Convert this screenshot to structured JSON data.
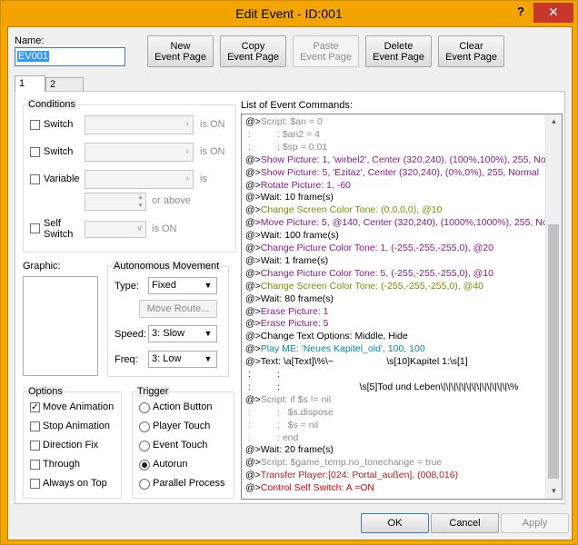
{
  "window": {
    "title": "Edit Event - ID:001",
    "help": "?",
    "close": "✕"
  },
  "name_label": "Name:",
  "name_value": "EV001",
  "top_buttons": [
    {
      "line1": "New",
      "line2": "Event Page"
    },
    {
      "line1": "Copy",
      "line2": "Event Page"
    },
    {
      "line1": "Paste",
      "line2": "Event Page"
    },
    {
      "line1": "Delete",
      "line2": "Event Page"
    },
    {
      "line1": "Clear",
      "line2": "Event Page"
    }
  ],
  "tabs": [
    "1",
    "2"
  ],
  "conditions": {
    "title": "Conditions",
    "switch1": "Switch",
    "switch2": "Switch",
    "variable": "Variable",
    "is_on1": "is ON",
    "is_on2": "is ON",
    "is": "is",
    "or_above": "or above",
    "self_switch_l1": "Self",
    "self_switch_l2": "Switch",
    "is_on3": "is ON"
  },
  "graphic_label": "Graphic:",
  "autonomous": {
    "title": "Autonomous Movement",
    "type_label": "Type:",
    "type_value": "Fixed",
    "move_route": "Move Route...",
    "speed_label": "Speed:",
    "speed_value": "3: Slow",
    "freq_label": "Freq:",
    "freq_value": "3: Low"
  },
  "options": {
    "title": "Options",
    "items": [
      {
        "label": "Move Animation",
        "checked": true
      },
      {
        "label": "Stop Animation",
        "checked": false
      },
      {
        "label": "Direction Fix",
        "checked": false
      },
      {
        "label": "Through",
        "checked": false
      },
      {
        "label": "Always on Top",
        "checked": false
      }
    ]
  },
  "trigger": {
    "title": "Trigger",
    "items": [
      {
        "label": "Action Button",
        "selected": false
      },
      {
        "label": "Player Touch",
        "selected": false
      },
      {
        "label": "Event Touch",
        "selected": false
      },
      {
        "label": "Autorun",
        "selected": true
      },
      {
        "label": "Parallel Process",
        "selected": false
      }
    ]
  },
  "list_label": "List of Event Commands:",
  "colors": {
    "script": "#8c8c8c",
    "picture": "#8b1a8b",
    "tone": "#7a8c00",
    "play": "#0088aa",
    "transfer": "#b22222",
    "switch": "#e00000",
    "default": "#000000"
  },
  "commands": [
    {
      "text": "@>Script: $an = 0",
      "c": "script"
    },
    {
      "text": " :          : $an2 = 4",
      "c": "script"
    },
    {
      "text": " :          : $sp = 0.01",
      "c": "script"
    },
    {
      "text": "@>Show Picture: 1, 'wirbel2', Center (320,240), (100%,100%), 255, Norm",
      "c": "picture"
    },
    {
      "text": "@>Show Picture: 5, 'Ezitaz', Center (320,240), (0%,0%), 255, Normal",
      "c": "picture"
    },
    {
      "text": "@>Rotate Picture: 1, -60",
      "c": "picture"
    },
    {
      "text": "@>Wait: 10 frame(s)",
      "c": "default"
    },
    {
      "text": "@>Change Screen Color Tone: (0,0,0,0), @10",
      "c": "tone"
    },
    {
      "text": "@>Move Picture: 5, @140, Center (320,240), (1000%,1000%), 255, Norm",
      "c": "picture"
    },
    {
      "text": "@>Wait: 100 frame(s)",
      "c": "default"
    },
    {
      "text": "@>Change Picture Color Tone: 1, (-255,-255,-255,0), @20",
      "c": "picture"
    },
    {
      "text": "@>Wait: 1 frame(s)",
      "c": "default"
    },
    {
      "text": "@>Change Picture Color Tone: 5, (-255,-255,-255,0), @10",
      "c": "picture"
    },
    {
      "text": "@>Change Screen Color Tone: (-255,-255,-255,0), @40",
      "c": "tone"
    },
    {
      "text": "@>Wait: 80 frame(s)",
      "c": "default"
    },
    {
      "text": "@>Erase Picture: 1",
      "c": "picture"
    },
    {
      "text": "@>Erase Picture: 5",
      "c": "picture"
    },
    {
      "text": "@>Change Text Options: Middle, Hide",
      "c": "default"
    },
    {
      "text": "@>Play ME: 'Neues Kapitel_old', 100, 100",
      "c": "play"
    },
    {
      "text": "@>Text: \\a[Text]\\%\\~                    \\s[10]Kapitel 1:\\s[1]",
      "c": "default"
    },
    {
      "text": " :          :",
      "c": "default"
    },
    {
      "text": " :          :                              \\s[5]Tod und Leben\\|\\|\\|\\|\\|\\|\\|\\|\\|\\|\\|\\|\\|\\%",
      "c": "default"
    },
    {
      "text": "@>Script: if $s != nil",
      "c": "script"
    },
    {
      "text": " :          :   $s.dispose",
      "c": "script"
    },
    {
      "text": " :          :   $s = nil",
      "c": "script"
    },
    {
      "text": " :          : end",
      "c": "script"
    },
    {
      "text": "@>Wait: 20 frame(s)",
      "c": "default"
    },
    {
      "text": "@>Script: $game_temp.no_tonechange = true",
      "c": "script"
    },
    {
      "text": "@>Transfer Player:[024: Portal_außen], (008,016)",
      "c": "transfer"
    },
    {
      "text": "@>Control Self Switch: A =ON",
      "c": "switch"
    }
  ],
  "bottom_buttons": {
    "ok": "OK",
    "cancel": "Cancel",
    "apply": "Apply"
  }
}
